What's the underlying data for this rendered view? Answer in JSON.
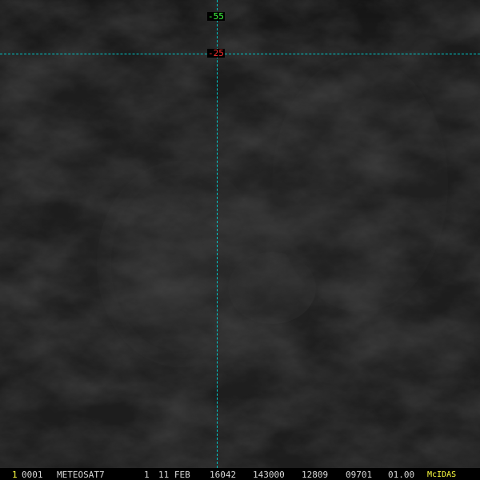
{
  "overlay": {
    "lat_label_top": "-55",
    "lat_label_line": "-25",
    "grid_color": "#00c8c8",
    "label_top_color": "#40ff40",
    "label_line_color": "#ff3030"
  },
  "status_bar": {
    "frame_number": "1",
    "area_number": "0001",
    "satellite": "METEOSAT7",
    "band": "1",
    "date": "11 FEB",
    "julian_day": "16042",
    "time": "143000",
    "ss_ec": "12809",
    "nav": "09701",
    "resolution": "01.00",
    "software": "McIDAS"
  }
}
